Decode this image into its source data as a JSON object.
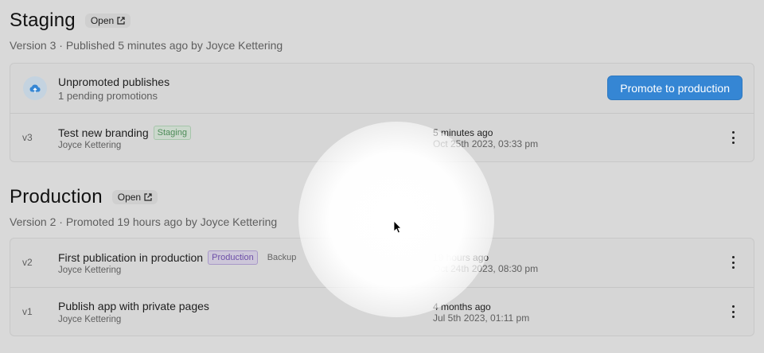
{
  "staging": {
    "title": "Staging",
    "open_label": "Open",
    "subtitle": "Version 3 · Published 5 minutes ago by Joyce Kettering",
    "promo": {
      "icon": "cloud-upload-icon",
      "title": "Unpromoted publishes",
      "subtitle": "1 pending promotions",
      "button_label": "Promote to production"
    },
    "versions": [
      {
        "version": "v3",
        "title": "Test new branding",
        "badge": "Staging",
        "author": "Joyce Kettering",
        "time_relative": "5 minutes ago",
        "time_absolute": "Oct 25th 2023, 03:33 pm"
      }
    ]
  },
  "production": {
    "title": "Production",
    "open_label": "Open",
    "subtitle": "Version 2 · Promoted 19 hours ago by Joyce Kettering",
    "versions": [
      {
        "version": "v2",
        "title": "First publication in production",
        "badge": "Production",
        "secondary_badge": "Backup",
        "author": "Joyce Kettering",
        "time_relative": "19 hours ago",
        "time_absolute": "Oct 24th 2023, 08:30 pm"
      },
      {
        "version": "v1",
        "title": "Publish app with private pages",
        "author": "Joyce Kettering",
        "time_relative": "4 months ago",
        "time_absolute": "Jul 5th 2023, 01:11 pm"
      }
    ]
  },
  "colors": {
    "background": "#d9d9d9",
    "accent": "#3586d4",
    "staging_badge": "#4d8c58",
    "production_badge": "#6e4fa8"
  }
}
